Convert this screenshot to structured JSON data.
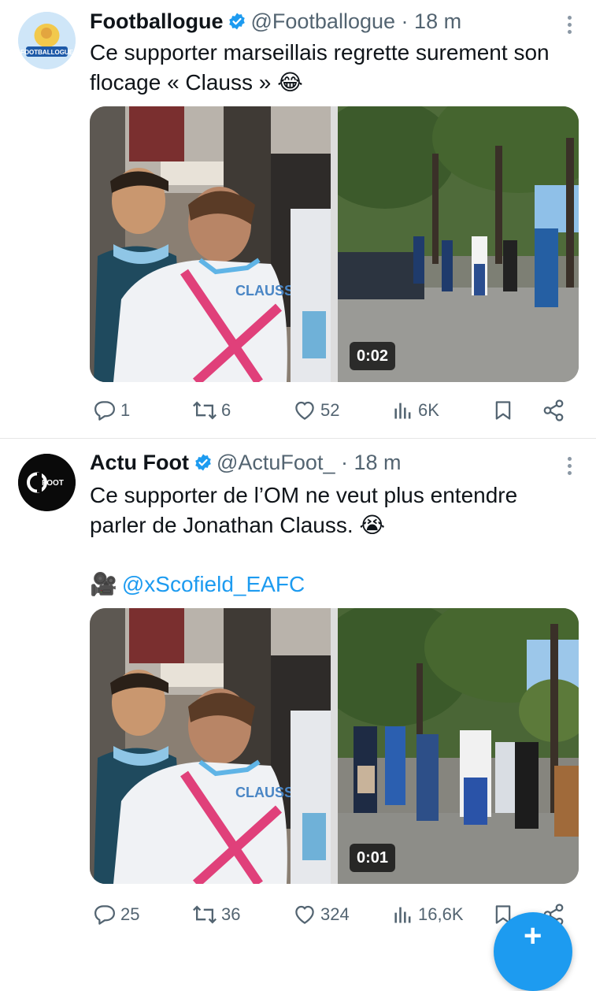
{
  "tweets": [
    {
      "name": "Footballogue",
      "handle": "@Footballogue",
      "separator": "·",
      "time": "18 m",
      "text": "Ce supporter marseillais regrette surement son flocage « Clauss » 😂",
      "avatar_text": "FOOTBALLOGUE",
      "media": {
        "left_jersey_text": "CLAUSS",
        "right_video_duration": "0:02"
      },
      "stats": {
        "replies": "1",
        "reposts": "6",
        "likes": "52",
        "views": "6K"
      }
    },
    {
      "name": "Actu Foot",
      "handle": "@ActuFoot_",
      "separator": "·",
      "time": "18 m",
      "text": "Ce supporter de l’OM ne veut plus entendre parler de Jonathan Clauss. 😭",
      "credit_icon": "🎥",
      "credit_link": "@xScofield_EAFC",
      "avatar_text": "FOOT",
      "media": {
        "left_jersey_text": "CLAUSS",
        "right_video_duration": "0:01"
      },
      "stats": {
        "replies": "25",
        "reposts": "36",
        "likes": "324",
        "views": "16,6K"
      }
    }
  ],
  "compose_button": {
    "label": "+"
  },
  "icons": [
    "verified-icon",
    "more-icon",
    "reply-icon",
    "repost-icon",
    "like-icon",
    "views-icon",
    "bookmark-icon",
    "share-icon",
    "camera-icon"
  ],
  "colors": {
    "accent": "#1d9bf0",
    "muted": "#536471",
    "text": "#0f1419"
  }
}
